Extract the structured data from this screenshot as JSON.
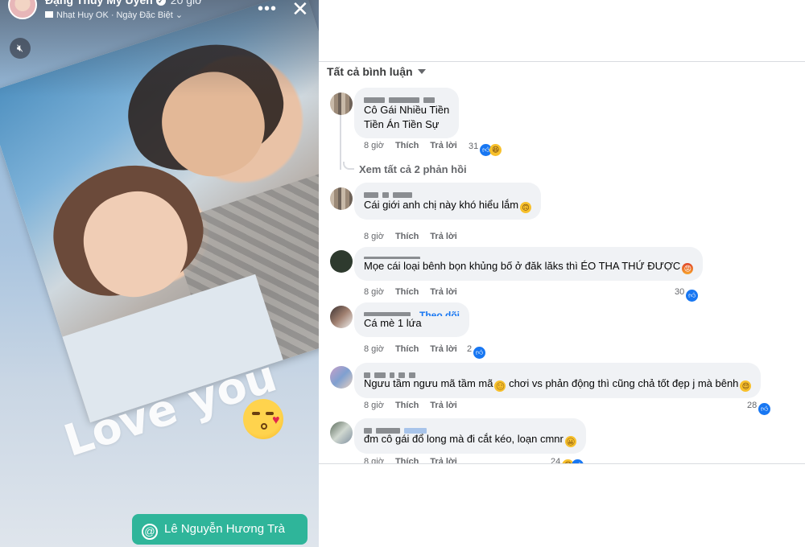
{
  "story": {
    "author_name": "Đặng Thuỳ Mỹ Uyên",
    "time": "20 giờ",
    "music_sub": "Nhạt Huy OK",
    "audience": "Ngày Đặc Biệt",
    "sticker_text": "Love you",
    "mention": "Lê Nguyễn Hương Trà",
    "icons": {
      "verified": "verified-badge-icon",
      "more": "more-dots-icon",
      "close": "close-icon",
      "mute": "speaker-mute-icon",
      "mention": "at-sign-icon",
      "emoji": "kissing-face-emoji"
    }
  },
  "comments_panel": {
    "filter_label": "Tất cả bình luận",
    "view_replies": "Xem tất cả 2 phản hồi",
    "comments": [
      {
        "name": "",
        "lines": [
          "Cô Gái Nhiều Tiền",
          "Tiền Án Tiền Sự"
        ],
        "time": "8 giờ",
        "like": "Thích",
        "reply": "Trả lời",
        "reaction_count": "31"
      },
      {
        "name": "",
        "lines": [
          "Cái giới anh chị này khó hiểu lắm"
        ],
        "time": "8 giờ",
        "like": "Thích",
        "reply": "Trả lời",
        "reaction_count": ""
      },
      {
        "name": "",
        "lines": [
          "Mọe cái loại bênh bọn khủng bố ở đăk lăks thì ÉO THA THỨ ĐƯỢC"
        ],
        "time": "8 giờ",
        "like": "Thích",
        "reply": "Trả lời",
        "reaction_count": "30"
      },
      {
        "name": "",
        "follow": "Theo dõi",
        "lines": [
          "Cá mè 1 lứa"
        ],
        "time": "8 giờ",
        "like": "Thích",
        "reply": "Trả lời",
        "reaction_count": "2"
      },
      {
        "name": "",
        "lines": [
          "Ngưu tầm ngưu mã tầm mã",
          " chơi vs phản động thì cũng chả tốt đẹp j mà bênh"
        ],
        "time": "8 giờ",
        "like": "Thích",
        "reply": "Trả lời",
        "reaction_count": "28"
      },
      {
        "name": "",
        "lines": [
          "đm cô gái đổ long mà đi cắt kéo, loạn cmnr"
        ],
        "time": "8 giờ",
        "like": "Thích",
        "reply": "Trả lời",
        "reaction_count": "24"
      }
    ]
  }
}
